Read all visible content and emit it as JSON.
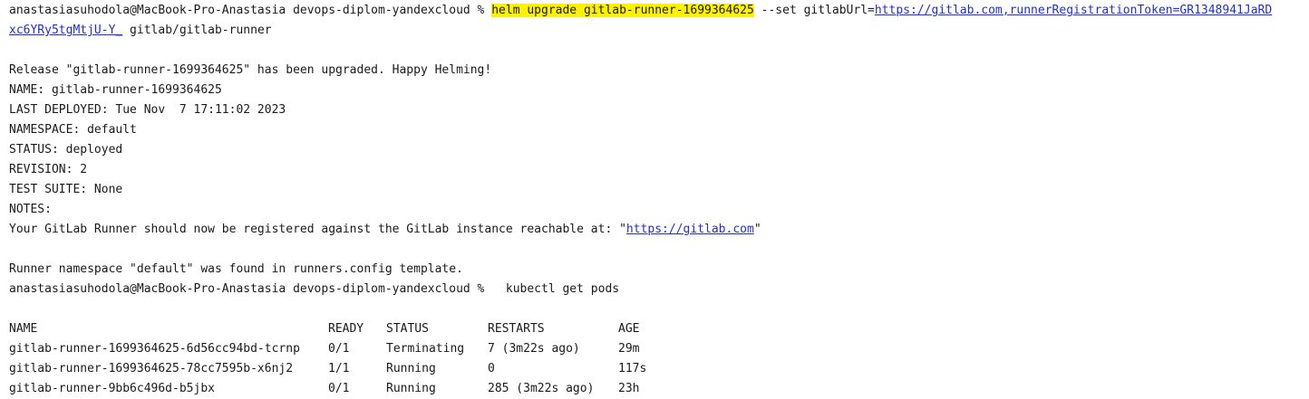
{
  "cmd1": {
    "prompt": "anastasiasuhodola@MacBook-Pro-Anastasia devops-diplom-yandexcloud % ",
    "highlighted": "helm upgrade gitlab-runner-1699364625",
    "args": " --set gitlabUrl=",
    "url_part1": "https://gitlab.com,runnerRegistrationToken=GR1348941JaRD",
    "url_part2": "xc6YRy5tgMtjU-Y_",
    "chart": " gitlab/gitlab-runner"
  },
  "output": {
    "release": "Release \"gitlab-runner-1699364625\" has been upgraded. Happy Helming!",
    "name": "NAME: gitlab-runner-1699364625",
    "last_deployed": "LAST DEPLOYED: Tue Nov  7 17:11:02 2023",
    "namespace": "NAMESPACE: default",
    "status": "STATUS: deployed",
    "revision": "REVISION: 2",
    "test_suite": "TEST SUITE: None",
    "notes": "NOTES:",
    "registered_prefix": "Your GitLab Runner should now be registered against the GitLab instance reachable at: \"",
    "registered_url": "https://gitlab.com",
    "registered_suffix": "\"",
    "runner_namespace": "Runner namespace \"default\" was found in runners.config template."
  },
  "cmd2": {
    "prompt": "anastasiasuhodola@MacBook-Pro-Anastasia devops-diplom-yandexcloud %",
    "command": "   kubectl get pods"
  },
  "pods": {
    "headers": [
      "NAME",
      "READY",
      "STATUS",
      "RESTARTS",
      "AGE"
    ],
    "rows": [
      [
        "gitlab-runner-1699364625-6d56cc94bd-tcrnp",
        "0/1",
        "Terminating",
        "7 (3m22s ago)",
        "29m"
      ],
      [
        "gitlab-runner-1699364625-78cc7595b-x6nj2",
        "1/1",
        "Running",
        "0",
        "117s"
      ],
      [
        "gitlab-runner-9bb6c496d-b5jbx",
        "0/1",
        "Running",
        "285 (3m22s ago)",
        "23h"
      ]
    ]
  },
  "colors": {
    "highlight": "#fff200",
    "link": "#1f2fd6",
    "text": "#1a1a1a",
    "background": "#ffffff"
  }
}
